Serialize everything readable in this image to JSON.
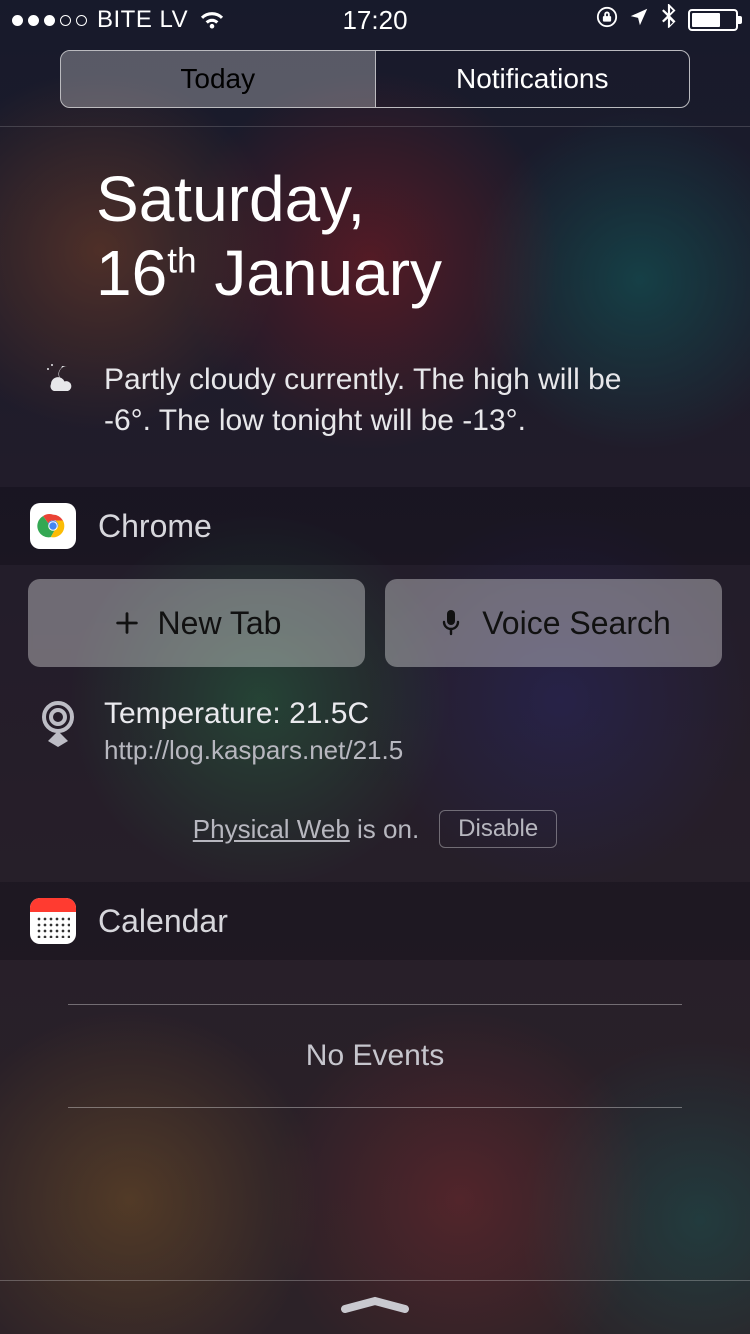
{
  "status": {
    "carrier": "BITE LV",
    "time": "17:20",
    "signal_active_dots": 3,
    "signal_total_dots": 5,
    "battery_percent": 60
  },
  "tabs": {
    "today": "Today",
    "notifications": "Notifications"
  },
  "date": {
    "weekday": "Saturday,",
    "day": "16",
    "ordinal": "th",
    "month": "January"
  },
  "weather": {
    "summary": "Partly cloudy currently. The high will be -6°. The low tonight will be -13°."
  },
  "chrome": {
    "title": "Chrome",
    "new_tab": "New Tab",
    "voice_search": "Voice Search",
    "physical_web": {
      "title": "Temperature: 21.5C",
      "url": "http://log.kaspars.net/21.5",
      "link_text": "Physical Web",
      "status_suffix": " is on.",
      "disable": "Disable"
    }
  },
  "calendar": {
    "title": "Calendar",
    "no_events": "No Events"
  }
}
